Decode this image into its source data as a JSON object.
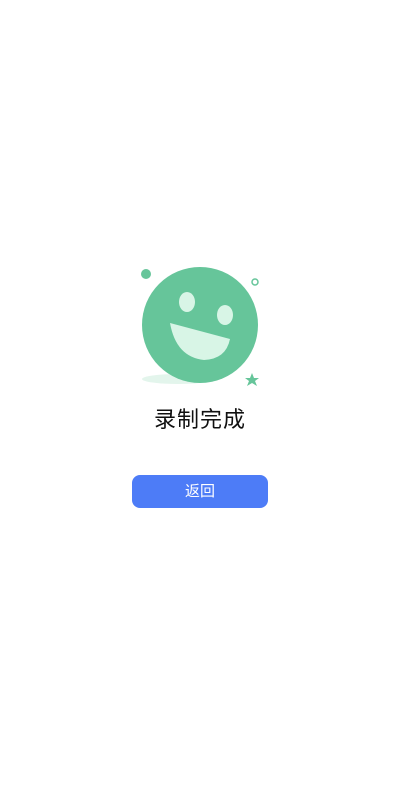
{
  "result": {
    "illustration_icon": "smiley-face-icon",
    "status_text": "录制完成"
  },
  "actions": {
    "back_label": "返回"
  },
  "colors": {
    "accent": "#4d7cf7",
    "illustration_green": "#66c59a",
    "illustration_highlight": "#d8f5e6",
    "background": "#ffffff"
  }
}
